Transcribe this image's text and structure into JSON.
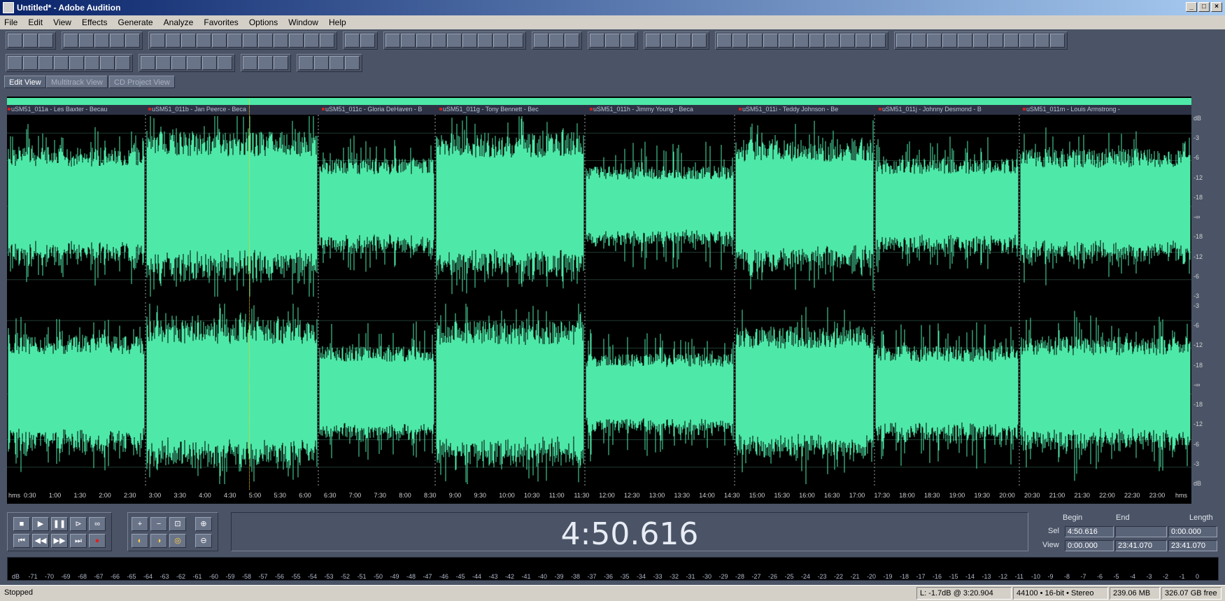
{
  "window": {
    "title": "Untitled* - Adobe Audition"
  },
  "menu": [
    "File",
    "Edit",
    "View",
    "Effects",
    "Generate",
    "Analyze",
    "Favorites",
    "Options",
    "Window",
    "Help"
  ],
  "view_tabs": [
    "Edit View",
    "Multitrack View",
    "CD Project View"
  ],
  "markers": [
    "uSM51_011a - Les Baxter - Becau",
    "uSM51_011b - Jan Peerce - Beca",
    "uSM51_011c - Gloria DeHaven - B",
    "uSM51_011g - Tony Bennett - Bec",
    "uSM51_011h - Jimmy Young - Beca",
    "uSM51_011i - Teddy Johnson - Be",
    "uSM51_011j - Johnny Desmond - B",
    "uSM51_011m - Louis Armstrong -"
  ],
  "db_scale_top": [
    "dB",
    "-3",
    "-6",
    "-12",
    "-18",
    "-∞",
    "-18",
    "-12",
    "-6",
    "-3"
  ],
  "db_scale_bottom": [
    "-3",
    "-6",
    "-12",
    "-18",
    "-∞",
    "-18",
    "-12",
    "-6",
    "-3",
    "dB"
  ],
  "timeline": [
    "hms",
    "0:30",
    "1:00",
    "1:30",
    "2:00",
    "2:30",
    "3:00",
    "3:30",
    "4:00",
    "4:30",
    "5:00",
    "5:30",
    "6:00",
    "6:30",
    "7:00",
    "7:30",
    "8:00",
    "8:30",
    "9:00",
    "9:30",
    "10:00",
    "10:30",
    "11:00",
    "11:30",
    "12:00",
    "12:30",
    "13:00",
    "13:30",
    "14:00",
    "14:30",
    "15:00",
    "15:30",
    "16:00",
    "16:30",
    "17:00",
    "17:30",
    "18:00",
    "18:30",
    "19:00",
    "19:30",
    "20:00",
    "20:30",
    "21:00",
    "21:30",
    "22:00",
    "22:30",
    "23:00",
    "hms"
  ],
  "time_display": "4:50.616",
  "selview": {
    "headers": [
      "Begin",
      "End",
      "Length"
    ],
    "sel_label": "Sel",
    "view_label": "View",
    "sel": [
      "4:50.616",
      "",
      "0:00.000"
    ],
    "view": [
      "0:00.000",
      "23:41.070",
      "23:41.070"
    ]
  },
  "meter_scale": [
    "dB",
    "-71",
    "-70",
    "-69",
    "-68",
    "-67",
    "-66",
    "-65",
    "-64",
    "-63",
    "-62",
    "-61",
    "-60",
    "-59",
    "-58",
    "-57",
    "-56",
    "-55",
    "-54",
    "-53",
    "-52",
    "-51",
    "-50",
    "-49",
    "-48",
    "-47",
    "-46",
    "-45",
    "-44",
    "-43",
    "-42",
    "-41",
    "-40",
    "-39",
    "-38",
    "-37",
    "-36",
    "-35",
    "-34",
    "-33",
    "-32",
    "-31",
    "-30",
    "-29",
    "-28",
    "-27",
    "-26",
    "-25",
    "-24",
    "-23",
    "-22",
    "-21",
    "-20",
    "-19",
    "-18",
    "-17",
    "-16",
    "-15",
    "-14",
    "-13",
    "-12",
    "-11",
    "-10",
    "-9",
    "-8",
    "-7",
    "-6",
    "-5",
    "-4",
    "-3",
    "-2",
    "-1",
    "0"
  ],
  "status": {
    "state": "Stopped",
    "level": "L: -1.7dB @  3:20.904",
    "format": "44100 • 16-bit • Stereo",
    "size": "239.06 MB",
    "free": "326.07 GB free"
  },
  "colors": {
    "waveform": "#4ee9a8",
    "background": "#000000",
    "chrome": "#4a5466"
  },
  "icons": [
    "minimize-icon",
    "maximize-icon",
    "close-icon",
    "stop-icon",
    "play-icon",
    "pause-icon",
    "play-to-end-icon",
    "loop-icon",
    "go-to-start-icon",
    "rewind-icon",
    "fast-forward-icon",
    "go-to-end-icon",
    "record-icon",
    "zoom-in-icon",
    "zoom-out-icon",
    "zoom-full-icon"
  ]
}
